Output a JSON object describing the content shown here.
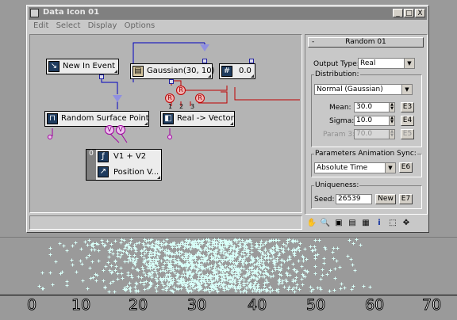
{
  "window": {
    "title": "Data Icon 01",
    "menu": [
      "Edit",
      "Select",
      "Display",
      "Options"
    ],
    "controls": {
      "minimize": "_",
      "maximize": "□",
      "close": "X"
    }
  },
  "graph": {
    "nodes": {
      "new_in_event": "New In Event",
      "gaussian": "Gaussian(30, 10)",
      "constant": "0.0",
      "random_surface_point": "Random Surface Point",
      "real_to_vector": "Real -> Vector",
      "v1v2": "V1 + V2",
      "position": "Position V...",
      "v1v2_index": "0"
    },
    "port_labels": {
      "r1": "R",
      "r2": "R",
      "r3": "R",
      "p1": "V",
      "p2": "V",
      "idx1": "1",
      "idx2": "2",
      "idx3": "3"
    }
  },
  "panel": {
    "header": "Random 01",
    "header_toggle": "-",
    "output_type_label": "Output Type:",
    "output_type_value": "Real",
    "distribution_label": "Distribution:",
    "distribution_value": "Normal (Gaussian)",
    "mean_label": "Mean:",
    "mean_value": "30.0",
    "mean_btn": "E3",
    "sigma_label": "Sigma:",
    "sigma_value": "10.0",
    "sigma_btn": "E4",
    "param3_label": "Param 3:",
    "param3_value": "70.0",
    "param3_btn": "E5",
    "sync_label": "Parameters Animation Sync:",
    "sync_value": "Absolute Time",
    "sync_btn": "E6",
    "uniqueness_label": "Uniqueness:",
    "seed_label": "Seed:",
    "seed_value": "26539",
    "new_btn": "New",
    "seed_btn": "E7"
  },
  "toolbar_icons": [
    "pan-icon",
    "zoom-icon",
    "zoom-region-icon",
    "zoom-extents-icon",
    "grid-icon",
    "info-icon",
    "select-icon",
    "move-icon"
  ],
  "viewport": {
    "ticks": [
      "0",
      "10",
      "20",
      "30",
      "40",
      "50",
      "60",
      "70"
    ]
  },
  "colors": {
    "particles": "#d8fff8",
    "title_bg": "#808080",
    "node_icon": "#1e3b5e"
  }
}
